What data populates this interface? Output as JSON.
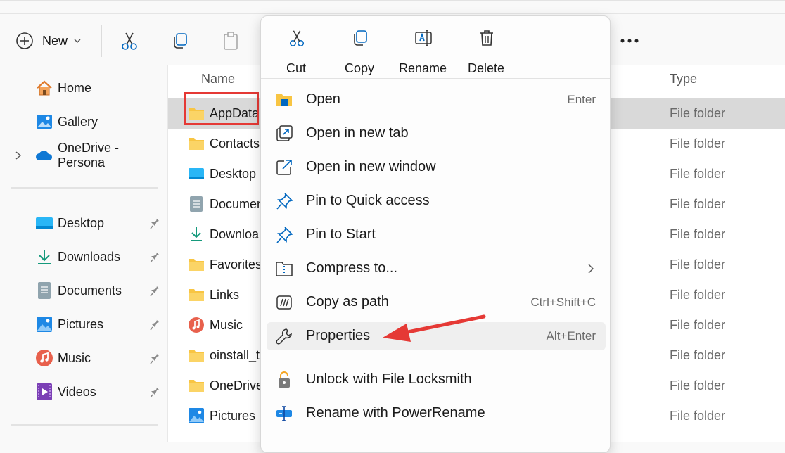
{
  "toolbar": {
    "new_label": "New",
    "icons": [
      "plus-icon",
      "cut-icon",
      "copy-icon",
      "paste-icon",
      "more-icon"
    ]
  },
  "sidebar": {
    "top": [
      {
        "label": "Home",
        "icon": "home-icon"
      },
      {
        "label": "Gallery",
        "icon": "gallery-icon"
      },
      {
        "label": "OneDrive - Persona",
        "icon": "onedrive-icon"
      }
    ],
    "quick": [
      {
        "label": "Desktop",
        "icon": "desktop-folder-icon"
      },
      {
        "label": "Downloads",
        "icon": "download-icon"
      },
      {
        "label": "Documents",
        "icon": "documents-icon"
      },
      {
        "label": "Pictures",
        "icon": "pictures-icon"
      },
      {
        "label": "Music",
        "icon": "music-icon"
      },
      {
        "label": "Videos",
        "icon": "videos-icon"
      }
    ]
  },
  "filelist": {
    "columns": {
      "name": "Name",
      "type": "Type"
    },
    "rows": [
      {
        "name": "AppData",
        "type": "File folder"
      },
      {
        "name": "Contacts",
        "type": "File folder"
      },
      {
        "name": "Desktop",
        "type": "File folder"
      },
      {
        "name": "Documer",
        "type": "File folder"
      },
      {
        "name": "Downloa",
        "type": "File folder"
      },
      {
        "name": "Favorites",
        "type": "File folder"
      },
      {
        "name": "Links",
        "type": "File folder"
      },
      {
        "name": "Music",
        "type": "File folder"
      },
      {
        "name": "oinstall_t",
        "type": "File folder"
      },
      {
        "name": "OneDrive",
        "type": "File folder"
      },
      {
        "name": "Pictures",
        "type": "File folder"
      }
    ]
  },
  "menu": {
    "quick_actions": [
      {
        "label": "Cut",
        "icon": "cut-icon"
      },
      {
        "label": "Copy",
        "icon": "copy-icon"
      },
      {
        "label": "Rename",
        "icon": "rename-icon"
      },
      {
        "label": "Delete",
        "icon": "delete-icon"
      }
    ],
    "items": [
      {
        "label": "Open",
        "shortcut": "Enter",
        "icon": "open-folder-icon"
      },
      {
        "label": "Open in new tab",
        "shortcut": "",
        "icon": "new-tab-icon"
      },
      {
        "label": "Open in new window",
        "shortcut": "",
        "icon": "new-window-icon"
      },
      {
        "label": "Pin to Quick access",
        "shortcut": "",
        "icon": "pin-icon"
      },
      {
        "label": "Pin to Start",
        "shortcut": "",
        "icon": "pin-icon"
      },
      {
        "label": "Compress to...",
        "shortcut": "",
        "icon": "zip-icon"
      },
      {
        "label": "Copy as path",
        "shortcut": "Ctrl+Shift+C",
        "icon": "copy-path-icon"
      },
      {
        "label": "Properties",
        "shortcut": "Alt+Enter",
        "icon": "wrench-icon"
      }
    ],
    "extra_items": [
      {
        "label": "Unlock with File Locksmith",
        "icon": "lock-icon"
      },
      {
        "label": "Rename with PowerRename",
        "icon": "power-rename-icon"
      }
    ]
  },
  "colors": {
    "accent": "#0067c0",
    "highlight_box": "#e53935",
    "arrow": "#e53935",
    "folder": "#f8c543"
  }
}
